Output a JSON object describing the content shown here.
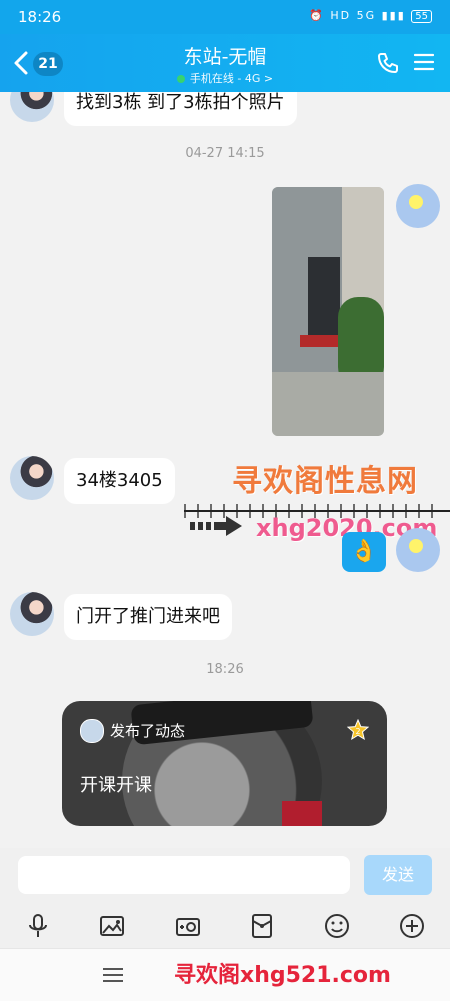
{
  "status_bar": {
    "time": "18:26",
    "icons_text": "⏰ HD 5G ▮▮▮",
    "battery": "55"
  },
  "header": {
    "badge_count": "21",
    "title": "东站-无帽",
    "subtitle": "手机在线 - 4G >"
  },
  "messages": {
    "msg1": "找到3栋  到了3栋拍个照片",
    "time1": "04-27 14:15",
    "msg2": "34楼3405",
    "ok_emoji": "👌",
    "msg3": "门开了推门进来吧",
    "time2": "18:26"
  },
  "card": {
    "header": "发布了动态",
    "text": "开课开课"
  },
  "watermarks": {
    "line1": "寻欢阁性息网",
    "line2": "xhg2020.com",
    "line3": "寻欢阁xhg521.com"
  },
  "input": {
    "placeholder": "",
    "send_label": "发送"
  },
  "colors": {
    "accent": "#12a6ec",
    "send_disabled": "#a8d8fb"
  }
}
